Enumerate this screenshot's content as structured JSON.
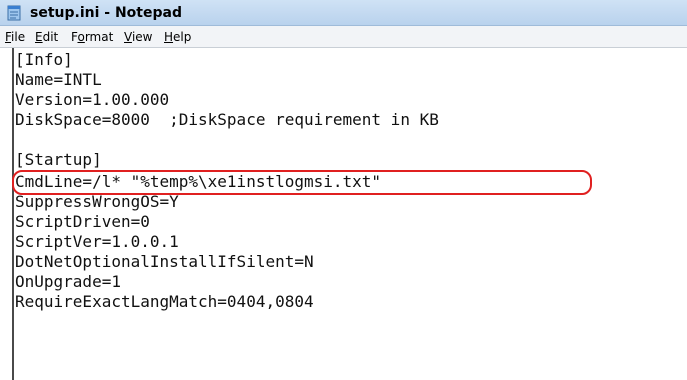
{
  "window": {
    "title": "setup.ini - Notepad",
    "icon": "notepad-icon"
  },
  "menu": [
    {
      "accel": "F",
      "rest": "ile"
    },
    {
      "accel": "E",
      "rest": "dit"
    },
    {
      "pre": "F",
      "accel": "o",
      "rest": "rmat"
    },
    {
      "accel": "V",
      "rest": "iew"
    },
    {
      "accel": "H",
      "rest": "elp"
    }
  ],
  "lines": [
    "[Info]",
    "Name=INTL",
    "Version=1.00.000",
    "DiskSpace=8000  ;DiskSpace requirement in KB",
    "",
    "[Startup]",
    "CmdLine=/l* \"%temp%\\xe1instlogmsi.txt\"",
    "SuppressWrongOS=Y",
    "ScriptDriven=0",
    "ScriptVer=1.0.0.1",
    "DotNetOptionalInstallIfSilent=N",
    "OnUpgrade=1",
    "RequireExactLangMatch=0404,0804"
  ],
  "highlight_color": "#e02020"
}
